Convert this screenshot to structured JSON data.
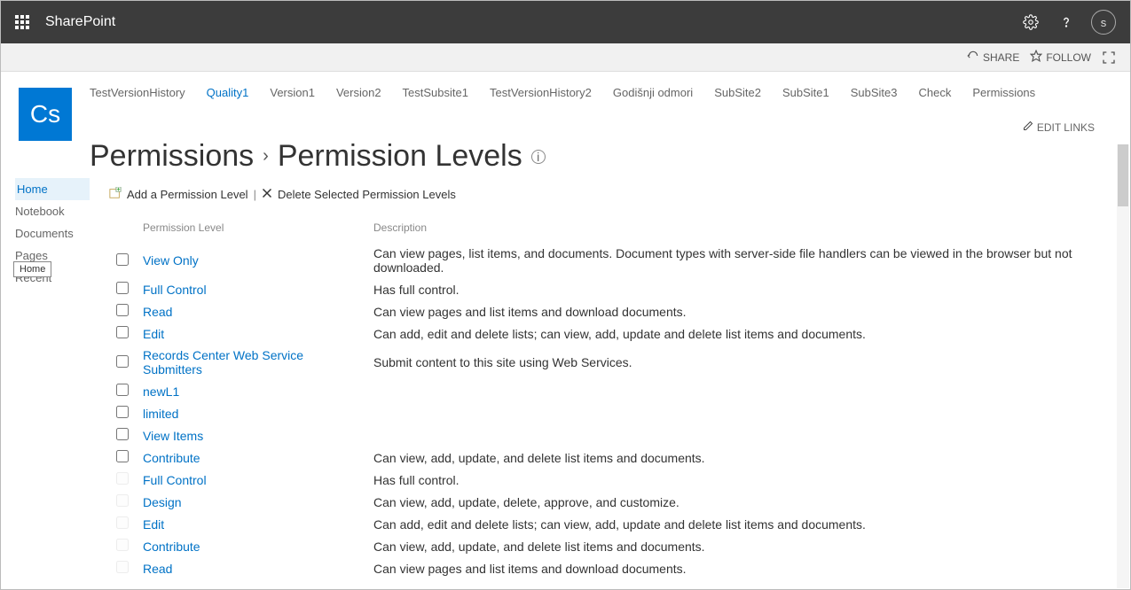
{
  "suite": {
    "brand": "SharePoint",
    "avatar_initial": "s"
  },
  "ribbon": {
    "share": "SHARE",
    "follow": "FOLLOW"
  },
  "site_logo_text": "Cs",
  "top_nav": {
    "items": [
      "TestVersionHistory",
      "Quality1",
      "Version1",
      "Version2",
      "TestSubsite1",
      "TestVersionHistory2",
      "Godišnji odmori",
      "SubSite2",
      "SubSite1",
      "SubSite3",
      "Check",
      "Permissions"
    ],
    "active_index": 1,
    "edit_links": "EDIT LINKS"
  },
  "page_title": {
    "crumb": "Permissions",
    "current": "Permission Levels"
  },
  "left_nav": {
    "items": [
      "Home",
      "Notebook",
      "Documents",
      "Pages",
      "Recent"
    ],
    "current_index": 0,
    "tooltip": "Home"
  },
  "toolbar": {
    "add": "Add a Permission Level",
    "delete": "Delete Selected Permission Levels"
  },
  "table": {
    "col_level": "Permission Level",
    "col_desc": "Description",
    "rows": [
      {
        "cb": true,
        "name": "View Only",
        "desc": "Can view pages, list items, and documents. Document types with server-side file handlers can be viewed in the browser but not downloaded."
      },
      {
        "cb": true,
        "name": "Full Control",
        "desc": "Has full control."
      },
      {
        "cb": true,
        "name": "Read",
        "desc": "Can view pages and list items and download documents."
      },
      {
        "cb": true,
        "name": "Edit",
        "desc": "Can add, edit and delete lists; can view, add, update and delete list items and documents."
      },
      {
        "cb": true,
        "name": "Records Center Web Service Submitters",
        "desc": "Submit content to this site using Web Services."
      },
      {
        "cb": true,
        "name": "newL1",
        "desc": ""
      },
      {
        "cb": true,
        "name": "limited",
        "desc": ""
      },
      {
        "cb": true,
        "name": "View Items",
        "desc": ""
      },
      {
        "cb": true,
        "name": "Contribute",
        "desc": "Can view, add, update, and delete list items and documents."
      },
      {
        "cb": false,
        "name": "Full Control",
        "desc": "Has full control."
      },
      {
        "cb": false,
        "name": "Design",
        "desc": "Can view, add, update, delete, approve, and customize."
      },
      {
        "cb": false,
        "name": "Edit",
        "desc": "Can add, edit and delete lists; can view, add, update and delete list items and documents."
      },
      {
        "cb": false,
        "name": "Contribute",
        "desc": "Can view, add, update, and delete list items and documents."
      },
      {
        "cb": false,
        "name": "Read",
        "desc": "Can view pages and list items and download documents."
      }
    ]
  }
}
